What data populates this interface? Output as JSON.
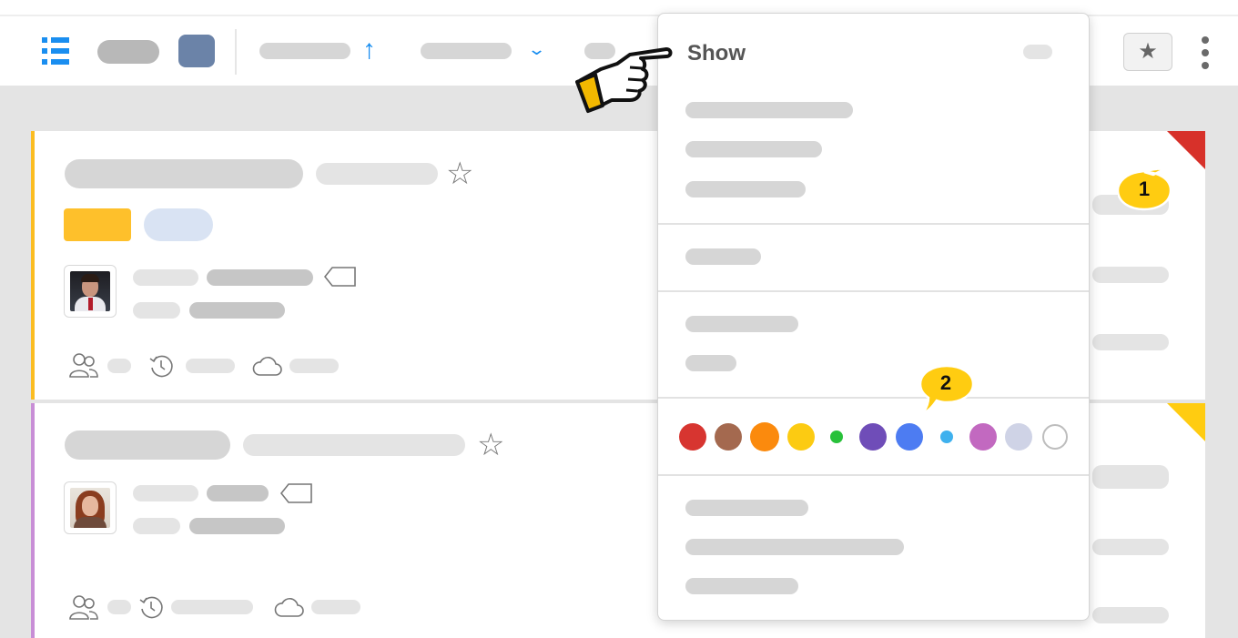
{
  "dropdown": {
    "title": "Show",
    "color_swatches": [
      {
        "name": "red",
        "color": "#d73530"
      },
      {
        "name": "brown",
        "color": "#a4694f"
      },
      {
        "name": "orange",
        "color": "#fb8a0d"
      },
      {
        "name": "yellow",
        "color": "#fccb12"
      },
      {
        "name": "green",
        "color": "#28c13a"
      },
      {
        "name": "purple",
        "color": "#6f4db8"
      },
      {
        "name": "blue",
        "color": "#4d7cf2"
      },
      {
        "name": "light-blue",
        "color": "#3fb1ee"
      },
      {
        "name": "pink",
        "color": "#c269c0"
      },
      {
        "name": "lavender",
        "color": "#cfd3e6"
      },
      {
        "name": "none",
        "color": "#ffffff"
      }
    ]
  },
  "callouts": {
    "one": "1",
    "two": "2"
  },
  "colors": {
    "accent": "#1a8ef0",
    "card_a_stripe": "#fbbd22",
    "card_b_stripe": "#c88ed6",
    "callout_yellow": "#ffcc11"
  },
  "toolbar": {
    "icons": [
      "list-view-icon",
      "sort-ascending-icon",
      "chevron-down-icon",
      "star-icon",
      "more-vertical-icon"
    ]
  }
}
